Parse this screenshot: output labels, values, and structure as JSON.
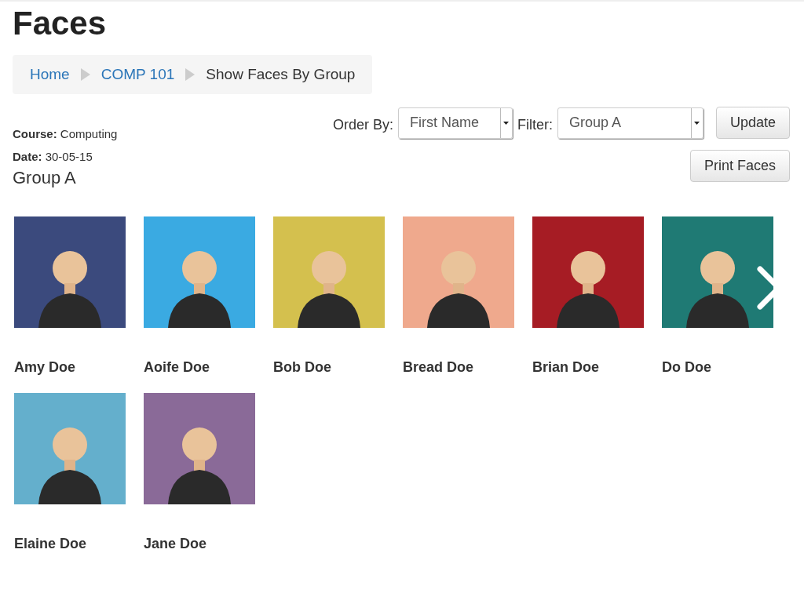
{
  "title": "Faces",
  "breadcrumb": [
    {
      "label": "Home",
      "kind": "link"
    },
    {
      "label": "COMP 101",
      "kind": "link"
    },
    {
      "label": "Show Faces By Group",
      "kind": "current"
    }
  ],
  "info": [
    {
      "label": "Course:",
      "value": "Computing"
    },
    {
      "label": "Date:",
      "value": "30-05-15"
    }
  ],
  "controls": {
    "order_label": "Order By:",
    "order_value": "First Name",
    "filter_label": "Filter:",
    "filter_value": "Group A",
    "update_button": "Update",
    "print_button": "Print Faces"
  },
  "group_title": "Group A",
  "students": [
    {
      "name": "Amy Doe",
      "color": "#3b4a7d"
    },
    {
      "name": "Aoife Doe",
      "color": "#3aaae2"
    },
    {
      "name": "Bob Doe",
      "color": "#d4c04e"
    },
    {
      "name": "Bread Doe",
      "color": "#efa98d"
    },
    {
      "name": "Brian Doe",
      "color": "#a61c24"
    },
    {
      "name": "Do Doe",
      "color": "#1f7a74"
    },
    {
      "name": "Elaine Doe",
      "color": "#64afcc"
    },
    {
      "name": "Jane Doe",
      "color": "#8a6a98"
    }
  ]
}
